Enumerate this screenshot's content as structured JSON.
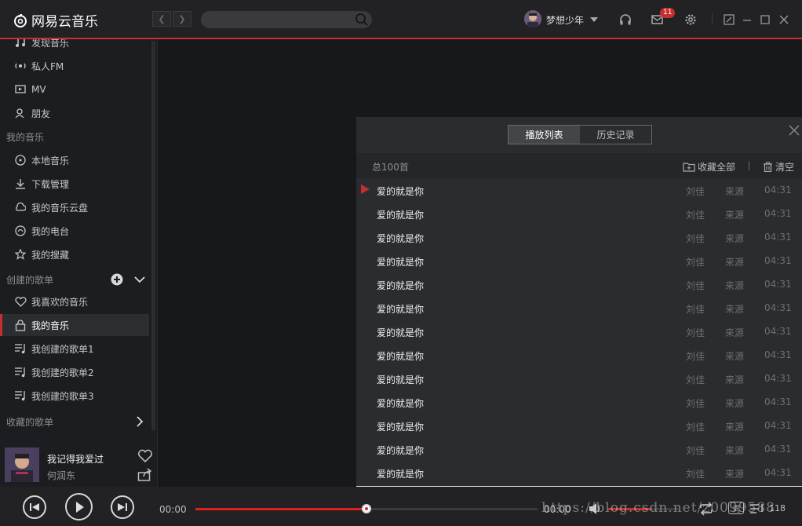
{
  "app": {
    "logo_text": "网易云音乐",
    "accent": "#c62f2f"
  },
  "header": {
    "search_placeholder": "",
    "username": "梦想少年",
    "message_badge": "11"
  },
  "sidebar": {
    "items_top": [
      {
        "label": "发现音乐",
        "icon": "music-note-icon"
      },
      {
        "label": "私人FM",
        "icon": "radio-wave-icon"
      },
      {
        "label": "MV",
        "icon": "video-icon"
      },
      {
        "label": "朋友",
        "icon": "friends-icon"
      }
    ],
    "my_music_title": "我的音乐",
    "my_music_items": [
      {
        "label": "本地音乐",
        "icon": "disc-icon"
      },
      {
        "label": "下载管理",
        "icon": "download-icon"
      },
      {
        "label": "我的音乐云盘",
        "icon": "cloud-icon"
      },
      {
        "label": "我的电台",
        "icon": "radio-icon"
      },
      {
        "label": "我的搜藏",
        "icon": "star-icon"
      }
    ],
    "created_title": "创建的歌单",
    "created_items": [
      {
        "label": "我喜欢的音乐",
        "icon": "heart-icon"
      },
      {
        "label": "我的音乐",
        "icon": "lock-icon",
        "active": true
      },
      {
        "label": "我创建的歌单1",
        "icon": "playlist-icon"
      },
      {
        "label": "我创建的歌单2",
        "icon": "playlist-icon"
      },
      {
        "label": "我创建的歌单3",
        "icon": "playlist-icon"
      }
    ],
    "collected_title": "收藏的歌单"
  },
  "now_playing": {
    "title": "我记得我爱过",
    "artist": "何润东"
  },
  "playlist_panel": {
    "tabs": [
      "播放列表",
      "历史记录"
    ],
    "active_tab": 0,
    "count_label": "总100首",
    "collect_all": "收藏全部",
    "clear": "清空",
    "rows": [
      {
        "title": "爱的就是你",
        "artist": "刘佳",
        "source": "来源",
        "duration": "04:31",
        "playing": true
      },
      {
        "title": "爱的就是你",
        "artist": "刘佳",
        "source": "来源",
        "duration": "04:31"
      },
      {
        "title": "爱的就是你",
        "artist": "刘佳",
        "source": "来源",
        "duration": "04:31"
      },
      {
        "title": "爱的就是你",
        "artist": "刘佳",
        "source": "来源",
        "duration": "04:31"
      },
      {
        "title": "爱的就是你",
        "artist": "刘佳",
        "source": "来源",
        "duration": "04:31"
      },
      {
        "title": "爱的就是你",
        "artist": "刘佳",
        "source": "来源",
        "duration": "04:31"
      },
      {
        "title": "爱的就是你",
        "artist": "刘佳",
        "source": "来源",
        "duration": "04:31"
      },
      {
        "title": "爱的就是你",
        "artist": "刘佳",
        "source": "来源",
        "duration": "04:31"
      },
      {
        "title": "爱的就是你",
        "artist": "刘佳",
        "source": "来源",
        "duration": "04:31"
      },
      {
        "title": "爱的就是你",
        "artist": "刘佳",
        "source": "来源",
        "duration": "04:31"
      },
      {
        "title": "爱的就是你",
        "artist": "刘佳",
        "source": "来源",
        "duration": "04:31"
      },
      {
        "title": "爱的就是你",
        "artist": "刘佳",
        "source": "来源",
        "duration": "04:31"
      },
      {
        "title": "爱的就是你",
        "artist": "刘佳",
        "source": "来源",
        "duration": "04:31"
      }
    ]
  },
  "player": {
    "current_time": "00:00",
    "total_time": "00:00",
    "progress": 0.5,
    "volume": 0.6,
    "list_count": "118"
  },
  "watermark": "https://blog.csdn.net/z0099588"
}
